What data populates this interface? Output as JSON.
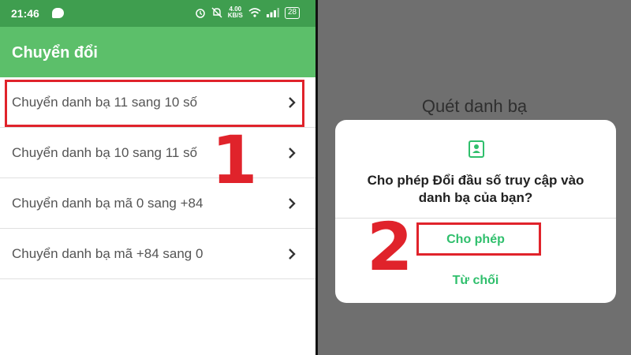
{
  "status_bar": {
    "time": "21:46",
    "speed_value": "4.00",
    "speed_unit": "KB/S",
    "battery": "28"
  },
  "app_bar": {
    "title": "Chuyển đổi"
  },
  "list": {
    "items": [
      {
        "label": "Chuyển danh bạ 11 sang 10 số"
      },
      {
        "label": "Chuyển danh bạ 10 sang 11 số"
      },
      {
        "label": "Chuyển danh bạ mã 0 sang +84"
      },
      {
        "label": "Chuyển danh bạ mã +84 sang 0"
      }
    ]
  },
  "annotations": {
    "step_1": "1",
    "step_2": "2"
  },
  "dialog_background": {
    "title": "Quét danh bạ"
  },
  "dialog": {
    "icon": "contacts-icon",
    "message": "Cho phép Đổi đầu số truy cập vào danh bạ của bạn?",
    "allow_label": "Cho phép",
    "deny_label": "Từ chối"
  },
  "colors": {
    "status_bar": "#3f9e4f",
    "app_bar": "#5cbf6a",
    "accent_green": "#2fbf6c",
    "annotation_red": "#e0232b"
  }
}
